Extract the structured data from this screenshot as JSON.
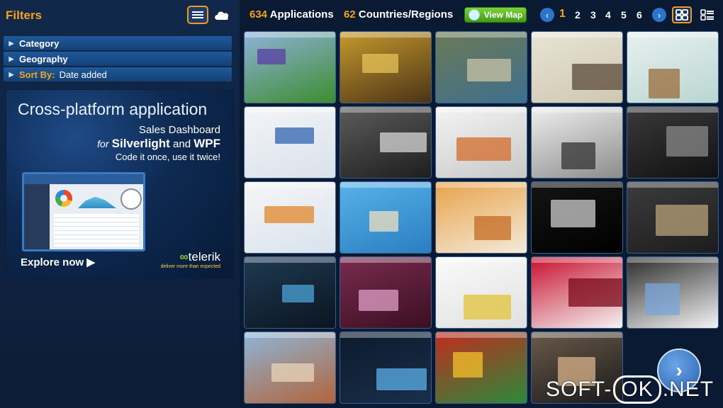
{
  "sidebar": {
    "title": "Filters",
    "filters": [
      {
        "label": "Category"
      },
      {
        "label": "Geography"
      }
    ],
    "sort": {
      "label": "Sort By:",
      "value": "Date added"
    }
  },
  "ad": {
    "headline": "Cross-platform application",
    "line1": "Sales Dashboard",
    "line2_prefix": "for",
    "line2_a": "Silverlight",
    "line2_and": "and",
    "line2_b": "WPF",
    "line3": "Code it once, use it twice!",
    "cta": "Explore now",
    "logo": "telerik",
    "tagline": "deliver more than expected"
  },
  "header": {
    "applications_count": "634",
    "applications_label": "Applications",
    "countries_count": "62",
    "countries_label": "Countries/Regions",
    "view_map": "View Map",
    "pages": [
      "1",
      "2",
      "3",
      "4",
      "5",
      "6"
    ],
    "current_page": "1"
  },
  "thumbnails": [
    {
      "name": "stadium-app",
      "colors": [
        "#8fb2da",
        "#3c8d2f"
      ],
      "accent": "#5a3ea3"
    },
    {
      "name": "cma-photo-wall",
      "colors": [
        "#c59a2b",
        "#4b3318"
      ],
      "accent": "#e7c25a"
    },
    {
      "name": "satellite-map",
      "colors": [
        "#6b7a55",
        "#3e6f8f"
      ],
      "accent": "#c9c3a4"
    },
    {
      "name": "1000-days-brand",
      "colors": [
        "#e8e4d6",
        "#cfc7b0"
      ],
      "accent": "#5b4a3a"
    },
    {
      "name": "photo-viewer",
      "colors": [
        "#e8f1ef",
        "#b9d6d1"
      ],
      "accent": "#9a6b3a"
    },
    {
      "name": "web-form-app",
      "colors": [
        "#f3f5f8",
        "#d9e1ea"
      ],
      "accent": "#2f64b0"
    },
    {
      "name": "media-player",
      "colors": [
        "#5c5c5c",
        "#1e1e1e"
      ],
      "accent": "#d7d7d7"
    },
    {
      "name": "photo-gallery",
      "colors": [
        "#f4f4f4",
        "#c8c8c8"
      ],
      "accent": "#d36b2a"
    },
    {
      "name": "news-portal",
      "colors": [
        "#efefef",
        "#8c8c8c"
      ],
      "accent": "#333333"
    },
    {
      "name": "dark-list",
      "colors": [
        "#3a3a3a",
        "#111111"
      ],
      "accent": "#8a8a8a"
    },
    {
      "name": "email-client",
      "colors": [
        "#f6f6f6",
        "#d8e2ee"
      ],
      "accent": "#e2872a"
    },
    {
      "name": "people-wall",
      "colors": [
        "#58b3e8",
        "#2a7ec1"
      ],
      "accent": "#f0e0c0"
    },
    {
      "name": "orange-profile",
      "colors": [
        "#e8a34a",
        "#f4eadb"
      ],
      "accent": "#c46b22"
    },
    {
      "name": "dark-swirl",
      "colors": [
        "#141414",
        "#000000"
      ],
      "accent": "#cfcfcf"
    },
    {
      "name": "map-viewer",
      "colors": [
        "#3c3c3c",
        "#1c1c1c"
      ],
      "accent": "#b9a27a"
    },
    {
      "name": "dark-timeline",
      "colors": [
        "#1e3a52",
        "#0b1520"
      ],
      "accent": "#4da3d9"
    },
    {
      "name": "ink-fashion",
      "colors": [
        "#7a2c4f",
        "#3a0f22"
      ],
      "accent": "#e0a0c8"
    },
    {
      "name": "3d-store",
      "colors": [
        "#fafafa",
        "#e0e0e0"
      ],
      "accent": "#e2c33a"
    },
    {
      "name": "nokia-shop",
      "colors": [
        "#c8102e",
        "#f4f4f4"
      ],
      "accent": "#7a0a1b"
    },
    {
      "name": "document-view",
      "colors": [
        "#2b2b2b",
        "#f4f4f4"
      ],
      "accent": "#7aa6d8"
    },
    {
      "name": "desert-scene",
      "colors": [
        "#8fb5d8",
        "#b0653a"
      ],
      "accent": "#e8d6b8"
    },
    {
      "name": "blue-charts",
      "colors": [
        "#0c1a2c",
        "#1a2f4a"
      ],
      "accent": "#5ab0e8"
    },
    {
      "name": "server-quest",
      "colors": [
        "#c12b1f",
        "#2a8a3a"
      ],
      "accent": "#f4c22b"
    },
    {
      "name": "video-player",
      "colors": [
        "#6a5a4a",
        "#1a1a1a"
      ],
      "accent": "#d8b18a"
    }
  ],
  "watermark": {
    "left": "SOFT-",
    "ok": "OK",
    "right": ".NET"
  }
}
